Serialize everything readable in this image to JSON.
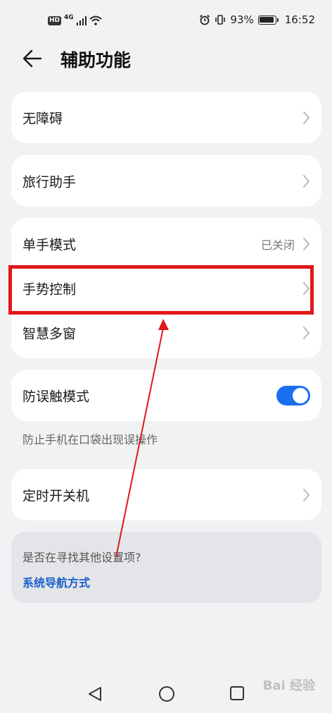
{
  "status_bar": {
    "hd": "HD",
    "network": "4G",
    "battery": "93%",
    "battery_level": 0.93,
    "time": "16:52"
  },
  "header": {
    "title": "辅助功能"
  },
  "items": {
    "accessibility": "无障碍",
    "travel_assistant": "旅行助手",
    "one_hand_mode": "单手模式",
    "one_hand_mode_value": "已关闭",
    "gesture_control": "手势控制",
    "smart_multiwindow": "智慧多窗",
    "anti_touch_mode": "防误触模式",
    "anti_touch_enabled": true,
    "anti_touch_hint": "防止手机在口袋出现误操作",
    "scheduled_power": "定时开关机"
  },
  "search_suggestion": {
    "question": "是否在寻找其他设置项?",
    "link": "系统导航方式"
  },
  "watermark": "Bai 经验",
  "colors": {
    "background": "#f1f2f4",
    "accent": "#1a6ff0",
    "link": "#1a5fcc",
    "annotation_red": "#e2161b"
  }
}
